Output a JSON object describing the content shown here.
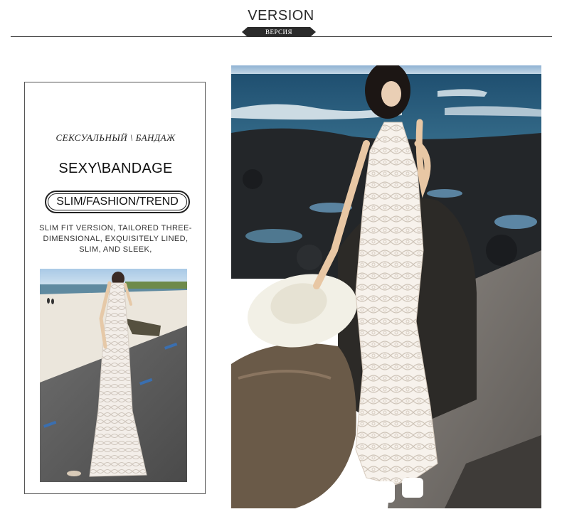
{
  "header": {
    "title": "VERSION",
    "subtitle": "ВЕРСИЯ",
    "tag_color": "#2b2b2b"
  },
  "card": {
    "subtitle": "СЕКСУАЛЬНЫЙ \\ БАНДАЖ",
    "title": "SEXY\\BANDAGE",
    "pill_text": "SLIM/FASHION/TREND",
    "description": "SLIM FIT VERSION, TAILORED THREE-DIMENSIONAL, EXQUISITELY LINED, SLIM, AND SLEEK,"
  },
  "photos": {
    "small": "woman-lace-dress-beach-road-photo",
    "large": "woman-lace-dress-sitting-on-rocks-sea-photo"
  }
}
